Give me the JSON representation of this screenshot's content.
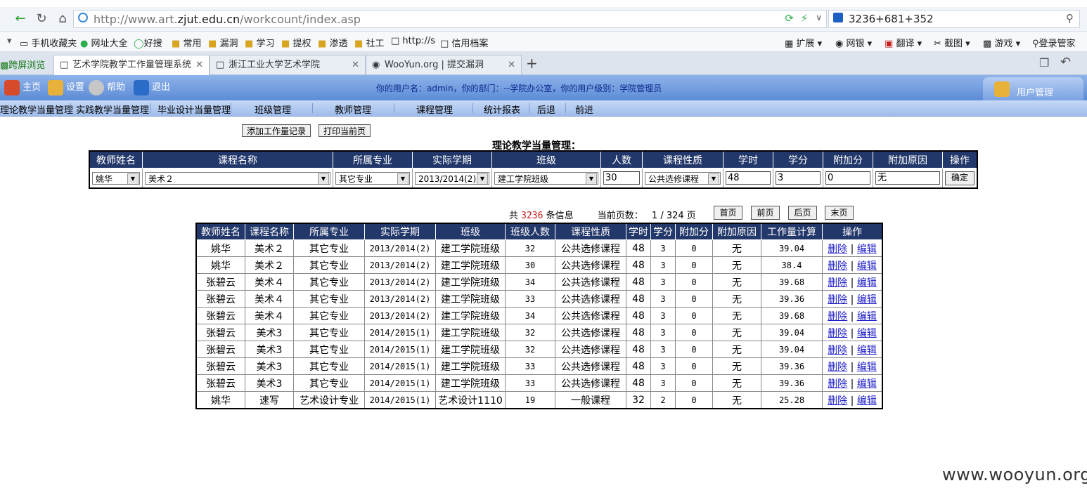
{
  "browser": {
    "url_prefix": "http://www.art.",
    "url_domain": "zjut.edu.cn",
    "url_path": "/workcount/index.asp",
    "search_text": "3236+681+352",
    "bookmarks": [
      "手机收藏夹",
      "网址大全",
      "好搜",
      "常用",
      "漏洞",
      "学习",
      "提权",
      "渗透",
      "社工",
      "http://s",
      "信用档案"
    ],
    "toolbar_right": [
      "扩展",
      "网银",
      "翻译",
      "截图",
      "游戏",
      "登录管家"
    ],
    "side_tab": "跨屏浏览",
    "tabs": [
      {
        "label": "艺术学院教学工作量管理系统",
        "active": true
      },
      {
        "label": "浙江工业大学艺术学院",
        "active": false
      },
      {
        "label": "WooYun.org | 提交漏洞",
        "active": false
      }
    ]
  },
  "header": {
    "buttons": [
      "主页",
      "设置",
      "帮助",
      "退出"
    ],
    "user_info": "你的用户名：admin，你的部门：--学院办公室，你的用户级别：学院管理员",
    "user_admin": "用户管理"
  },
  "nav": [
    "理论教学当量管理",
    "实践教学当量管理",
    "毕业设计当量管理",
    "班级管理",
    "教师管理",
    "课程管理",
    "统计报表",
    "后退",
    "前进"
  ],
  "actions": {
    "add": "添加工作量记录",
    "print": "打印当前页"
  },
  "form": {
    "title": "理论教学当量管理：",
    "headers": [
      "教师姓名",
      "课程名称",
      "所属专业",
      "实际学期",
      "班级",
      "人数",
      "课程性质",
      "学时",
      "学分",
      "附加分",
      "附加原因",
      "操作"
    ],
    "teacher": "姚华",
    "course": "美术２",
    "major": "其它专业",
    "term": "2013/2014(2)",
    "class": "建工学院班级",
    "count": "30",
    "nature": "公共选修课程",
    "hours": "48",
    "credits": "3",
    "bonus": "0",
    "bonus_reason": "无",
    "confirm": "确定"
  },
  "pager": {
    "prefix": "共",
    "total": "3236",
    "suffix": "条信息",
    "page_label": "当前页数：",
    "page": "1 / 324 页",
    "first": "首页",
    "prev": "前页",
    "next": "后页",
    "last": "末页"
  },
  "table": {
    "headers": [
      "教师姓名",
      "课程名称",
      "所属专业",
      "实际学期",
      "班级",
      "班级人数",
      "课程性质",
      "学时",
      "学分",
      "附加分",
      "附加原因",
      "工作量计算",
      "操作"
    ],
    "delete_label": "删除",
    "edit_label": "编辑",
    "rows": [
      [
        "姚华",
        "美术２",
        "其它专业",
        "2013/2014(2)",
        "建工学院班级",
        "32",
        "公共选修课程",
        "48",
        "3",
        "0",
        "无",
        "39.04"
      ],
      [
        "姚华",
        "美术２",
        "其它专业",
        "2013/2014(2)",
        "建工学院班级",
        "30",
        "公共选修课程",
        "48",
        "3",
        "0",
        "无",
        "38.4"
      ],
      [
        "张碧云",
        "美术４",
        "其它专业",
        "2013/2014(2)",
        "建工学院班级",
        "34",
        "公共选修课程",
        "48",
        "3",
        "0",
        "无",
        "39.68"
      ],
      [
        "张碧云",
        "美术４",
        "其它专业",
        "2013/2014(2)",
        "建工学院班级",
        "33",
        "公共选修课程",
        "48",
        "3",
        "0",
        "无",
        "39.36"
      ],
      [
        "张碧云",
        "美术４",
        "其它专业",
        "2013/2014(2)",
        "建工学院班级",
        "34",
        "公共选修课程",
        "48",
        "3",
        "0",
        "无",
        "39.68"
      ],
      [
        "张碧云",
        "美术3",
        "其它专业",
        "2014/2015(1)",
        "建工学院班级",
        "32",
        "公共选修课程",
        "48",
        "3",
        "0",
        "无",
        "39.04"
      ],
      [
        "张碧云",
        "美术3",
        "其它专业",
        "2014/2015(1)",
        "建工学院班级",
        "32",
        "公共选修课程",
        "48",
        "3",
        "0",
        "无",
        "39.04"
      ],
      [
        "张碧云",
        "美术3",
        "其它专业",
        "2014/2015(1)",
        "建工学院班级",
        "33",
        "公共选修课程",
        "48",
        "3",
        "0",
        "无",
        "39.36"
      ],
      [
        "张碧云",
        "美术3",
        "其它专业",
        "2014/2015(1)",
        "建工学院班级",
        "33",
        "公共选修课程",
        "48",
        "3",
        "0",
        "无",
        "39.36"
      ],
      [
        "姚华",
        "速写",
        "艺术设计专业",
        "2014/2015(1)",
        "艺术设计1110",
        "19",
        "一般课程",
        "32",
        "2",
        "0",
        "无",
        "25.28"
      ]
    ]
  },
  "watermark": "www.wooyun.org"
}
